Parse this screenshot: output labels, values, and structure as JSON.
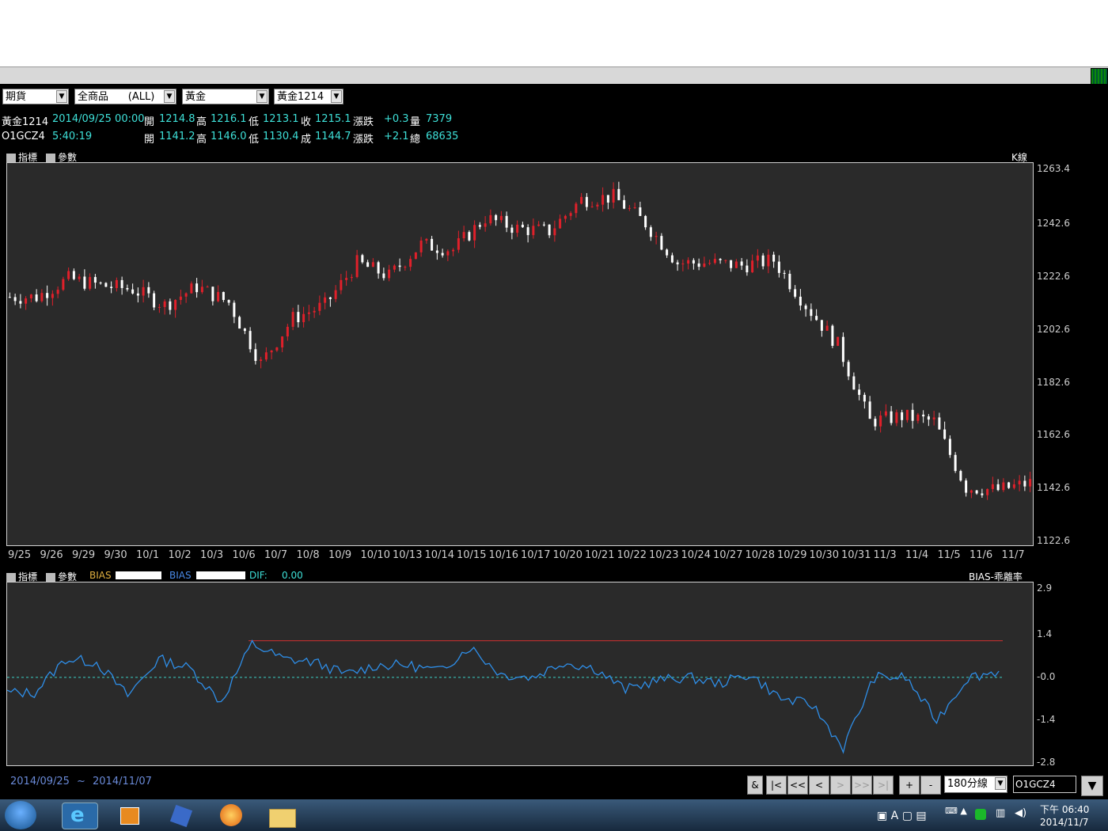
{
  "selectors": [
    {
      "value": "期貨"
    },
    {
      "value": "全商品      (ALL)"
    },
    {
      "value": "黃金"
    },
    {
      "value": "黃金1214"
    }
  ],
  "quote1": {
    "symbol": "黃金1214",
    "datetime": "2014/09/25 00:00",
    "open_label": "開",
    "open": "1214.8",
    "high_label": "高",
    "high": "1216.1",
    "low_label": "低",
    "low": "1213.1",
    "close_label": "收",
    "close": "1215.1",
    "change_label": "漲跌",
    "change": "+0.3",
    "vol_label": "量",
    "volume": "7379"
  },
  "quote2": {
    "symbol": "O1GCZ4",
    "time": "5:40:19",
    "open_label": "開",
    "open": "1141.2",
    "high_label": "高",
    "high": "1146.0",
    "low_label": "低",
    "low": "1130.4",
    "close_label": "成",
    "close": "1144.7",
    "change_label": "漲跌",
    "change": "+2.1",
    "vol_label": "總",
    "volume": "68635"
  },
  "price_toolbar": {
    "indicator_label": "指標",
    "param_label": "參數",
    "kline_label": "K線"
  },
  "ind_toolbar": {
    "indicator_label": "指標",
    "param_label": "參數",
    "bias1": "BIAS",
    "bias2": "BIAS",
    "dif_label": "DIF:",
    "dif_value": "0.00",
    "title": "BIAS-乖離率"
  },
  "chart_data": [
    {
      "type": "candlestick",
      "title": "K線",
      "ylim": [
        1122.6,
        1263.4
      ],
      "y_ticks": [
        "1263.4",
        "1242.6",
        "1222.6",
        "1202.6",
        "1182.6",
        "1162.6",
        "1142.6",
        "1122.6"
      ],
      "x_labels": [
        "9/25",
        "9/26",
        "9/29",
        "9/30",
        "10/1",
        "10/2",
        "10/3",
        "10/6",
        "10/7",
        "10/8",
        "10/9",
        "10/10",
        "10/13",
        "10/14",
        "10/15",
        "10/16",
        "10/17",
        "10/20",
        "10/21",
        "10/22",
        "10/23",
        "10/24",
        "10/27",
        "10/28",
        "10/29",
        "10/30",
        "10/31",
        "11/3",
        "11/4",
        "11/5",
        "11/6",
        "11/7"
      ],
      "closes": [
        1215.1,
        1222.0,
        1219.5,
        1218.0,
        1212.0,
        1219.0,
        1213.0,
        1190.0,
        1207.0,
        1212.0,
        1228.0,
        1223.0,
        1235.0,
        1233.0,
        1245.0,
        1241.0,
        1240.0,
        1252.0,
        1253.0,
        1243.0,
        1228.0,
        1228.0,
        1227.0,
        1229.0,
        1212.0,
        1197.0,
        1168.0,
        1170.0,
        1168.0,
        1143.0,
        1142.0,
        1144.7
      ],
      "grid": false,
      "legend": "none"
    },
    {
      "type": "line",
      "title": "BIAS-乖離率",
      "ylim": [
        -2.8,
        2.9
      ],
      "y_ticks": [
        "2.9",
        "1.4",
        "-0.0",
        "-1.4",
        "-2.8"
      ],
      "x_labels": [
        "9/25",
        "9/26",
        "9/29",
        "9/30",
        "10/1",
        "10/2",
        "10/3",
        "10/6",
        "10/7",
        "10/8",
        "10/9",
        "10/10",
        "10/13",
        "10/14",
        "10/15",
        "10/16",
        "10/17",
        "10/20",
        "10/21",
        "10/22",
        "10/23",
        "10/24",
        "10/27",
        "10/28",
        "10/29",
        "10/30",
        "10/31",
        "11/3",
        "11/4",
        "11/5",
        "11/6",
        "11/7"
      ],
      "values": [
        -0.5,
        0.6,
        0.5,
        -0.6,
        0.6,
        0.3,
        -0.8,
        1.1,
        0.6,
        0.5,
        0.1,
        0.4,
        0.4,
        0.2,
        1.0,
        0.1,
        0.0,
        0.5,
        0.3,
        -0.4,
        -0.1,
        0.0,
        -0.2,
        0.1,
        -0.7,
        -0.9,
        -2.3,
        0.0,
        0.0,
        -1.4,
        0.0,
        0.2
      ],
      "reference_lines": [
        1.2,
        0.0
      ],
      "grid": false,
      "legend": "none"
    }
  ],
  "date_range": {
    "start": "2014/09/25",
    "sep": "~",
    "end": "2014/11/07"
  },
  "nav_buttons": [
    "&",
    "|<",
    "<<",
    "<",
    ">",
    ">>",
    ">|",
    "+",
    "-"
  ],
  "period_select": "180分線",
  "symbol_input": "O1GCZ4",
  "taskbar": {
    "time": "下午 06:40",
    "date": "2014/11/7"
  },
  "colors": {
    "up": "#e0202a",
    "down": "#ffffff",
    "bias": "#2e8ee8",
    "ref_line": "#d03030",
    "zero_line": "#3ad0c8"
  }
}
